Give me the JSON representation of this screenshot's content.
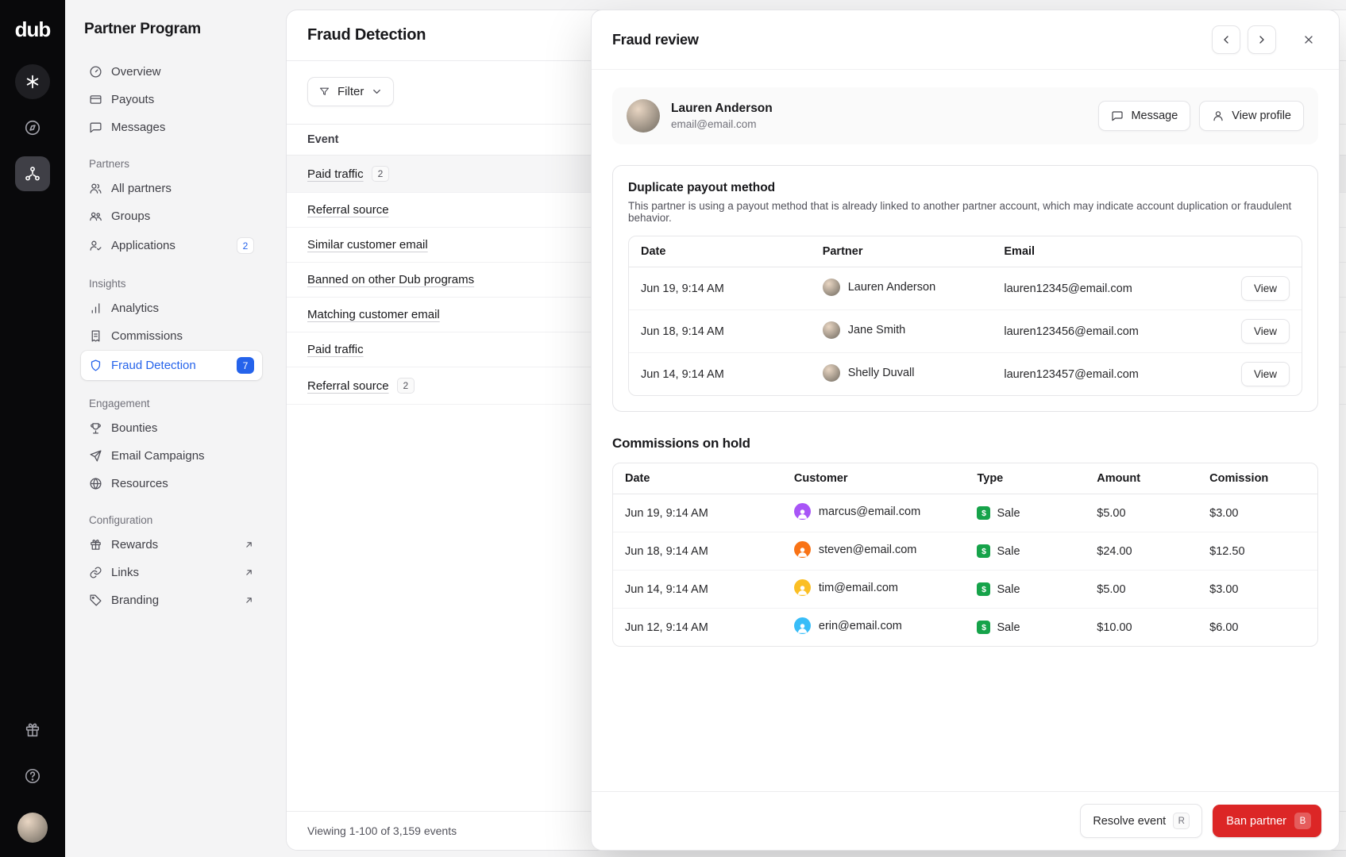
{
  "rail": {
    "logo": "dub"
  },
  "sidebar": {
    "title": "Partner Program",
    "sections": [
      {
        "items": [
          {
            "label": "Overview"
          },
          {
            "label": "Payouts"
          },
          {
            "label": "Messages"
          }
        ]
      },
      {
        "label": "Partners",
        "items": [
          {
            "label": "All partners"
          },
          {
            "label": "Groups"
          },
          {
            "label": "Applications",
            "badge": "2"
          }
        ]
      },
      {
        "label": "Insights",
        "items": [
          {
            "label": "Analytics"
          },
          {
            "label": "Commissions"
          },
          {
            "label": "Fraud Detection",
            "badge": "7"
          }
        ]
      },
      {
        "label": "Engagement",
        "items": [
          {
            "label": "Bounties"
          },
          {
            "label": "Email Campaigns"
          },
          {
            "label": "Resources"
          }
        ]
      },
      {
        "label": "Configuration",
        "items": [
          {
            "label": "Rewards"
          },
          {
            "label": "Links"
          },
          {
            "label": "Branding"
          }
        ]
      }
    ]
  },
  "main": {
    "title": "Fraud Detection",
    "filter_label": "Filter",
    "table": {
      "header": "Event",
      "rows": [
        {
          "label": "Paid traffic",
          "badge": "2"
        },
        {
          "label": "Referral source"
        },
        {
          "label": "Similar customer email"
        },
        {
          "label": "Banned on other Dub programs"
        },
        {
          "label": "Matching customer email"
        },
        {
          "label": "Paid traffic"
        },
        {
          "label": "Referral source",
          "badge": "2"
        }
      ]
    },
    "footer": "Viewing 1-100 of 3,159 events"
  },
  "modal": {
    "title": "Fraud review",
    "partner": {
      "name": "Lauren Anderson",
      "email": "email@email.com",
      "message_label": "Message",
      "view_profile_label": "View profile"
    },
    "fraud_card": {
      "title": "Duplicate payout method",
      "description": "This partner is using a payout method that is already linked to another partner account, which may indicate account duplication or fraudulent behavior.",
      "columns": [
        "Date",
        "Partner",
        "Email"
      ],
      "view_label": "View",
      "rows": [
        {
          "date": "Jun 19, 9:14 AM",
          "partner": "Lauren Anderson",
          "email": "lauren12345@email.com"
        },
        {
          "date": "Jun 18, 9:14 AM",
          "partner": "Jane Smith",
          "email": "lauren123456@email.com"
        },
        {
          "date": "Jun 14, 9:14 AM",
          "partner": "Shelly Duvall",
          "email": "lauren123457@email.com"
        }
      ]
    },
    "commissions": {
      "title": "Commissions on hold",
      "columns": [
        "Date",
        "Customer",
        "Type",
        "Amount",
        "Comission"
      ],
      "rows": [
        {
          "date": "Jun 19, 9:14 AM",
          "customer": "marcus@email.com",
          "type": "Sale",
          "amount": "$5.00",
          "commission": "$3.00",
          "avatar_color": "#a855f7"
        },
        {
          "date": "Jun 18, 9:14 AM",
          "customer": "steven@email.com",
          "type": "Sale",
          "amount": "$24.00",
          "commission": "$12.50",
          "avatar_color": "#f97316"
        },
        {
          "date": "Jun 14, 9:14 AM",
          "customer": "tim@email.com",
          "type": "Sale",
          "amount": "$5.00",
          "commission": "$3.00",
          "avatar_color": "#fbbf24"
        },
        {
          "date": "Jun 12, 9:14 AM",
          "customer": "erin@email.com",
          "type": "Sale",
          "amount": "$10.00",
          "commission": "$6.00",
          "avatar_color": "#38bdf8"
        }
      ]
    },
    "footer": {
      "resolve_label": "Resolve event",
      "resolve_kbd": "R",
      "ban_label": "Ban partner",
      "ban_kbd": "B"
    }
  },
  "colors": {
    "accent_blue": "#2563eb",
    "danger_red": "#dc2626",
    "sale_green": "#16a34a"
  }
}
